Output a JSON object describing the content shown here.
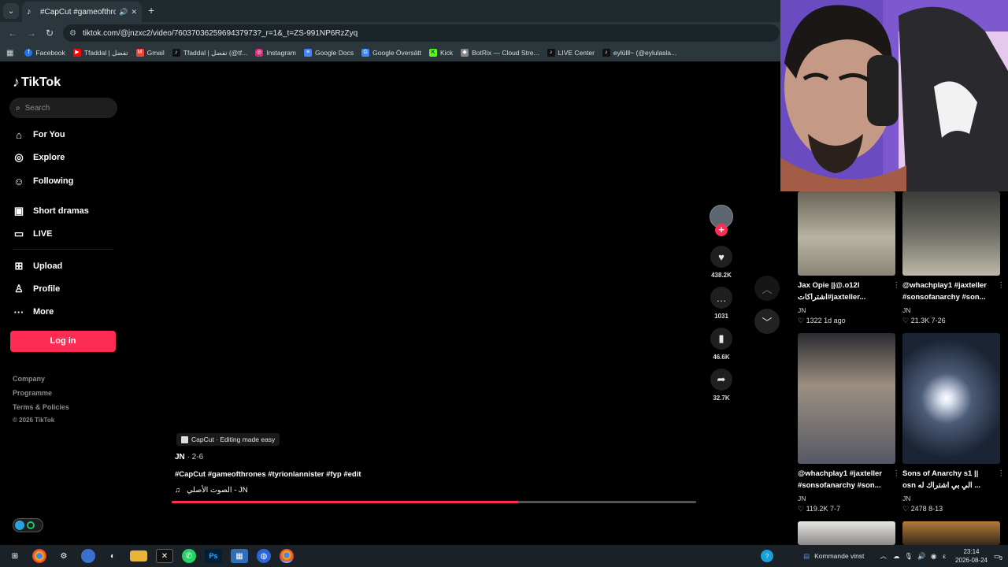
{
  "browser": {
    "tab_title": "#CapCut #gameofthrones #",
    "url": "tiktok.com/@jnzxc2/video/7603703625969437973?_r=1&_t=ZS-991NP6RzZyq",
    "bookmarks": [
      {
        "label": "Facebook",
        "icon": "facebook-icon",
        "color": "#1877f2"
      },
      {
        "label": "Tfaddal | تفضل",
        "icon": "youtube-icon",
        "color": "#ff0000"
      },
      {
        "label": "Gmail",
        "icon": "gmail-icon",
        "color": "#ea4335"
      },
      {
        "label": "Tfaddal | تفضل (@tf...",
        "icon": "tiktok-icon",
        "color": "#000000"
      },
      {
        "label": "Instagram",
        "icon": "instagram-icon",
        "color": "#d62976"
      },
      {
        "label": "Google Docs",
        "icon": "docs-icon",
        "color": "#4285f4"
      },
      {
        "label": "Google Översätt",
        "icon": "translate-icon",
        "color": "#4285f4"
      },
      {
        "label": "Kick",
        "icon": "kick-icon",
        "color": "#53fc18"
      },
      {
        "label": "BotRix — Cloud Stre...",
        "icon": "botrix-icon",
        "color": "#cccccc"
      },
      {
        "label": "LIVE Center",
        "icon": "tiktok-icon",
        "color": "#000000"
      },
      {
        "label": "eylülll~ (@eylulasla...",
        "icon": "tiktok-icon",
        "color": "#000000"
      }
    ]
  },
  "sidebar": {
    "logo": "TikTok",
    "search_placeholder": "Search",
    "nav": [
      "For You",
      "Explore",
      "Following",
      "Short dramas",
      "LIVE",
      "Upload",
      "Profile",
      "More"
    ],
    "login": "Log in",
    "footer": [
      "Company",
      "Programme",
      "Terms & Policies"
    ],
    "copyright": "© 2026 TikTok"
  },
  "video": {
    "capcut_label": "CapCut · Editing made easy",
    "author": "JN",
    "date": " · 2-6",
    "description": "#CapCut #gameofthrones #tyrionlannister #fyp #edit",
    "music": "الصوت الأصلي - JN",
    "progress": 0.66,
    "likes": "438.2K",
    "comments": "1031",
    "saves": "46.6K",
    "shares": "32.7K"
  },
  "related": [
    {
      "title": "Jax Opie ||@.o12l",
      "subtitle": "اشتراكات#jaxteller...",
      "author": "JN",
      "likes": "1322",
      "date": "1d ago"
    },
    {
      "title": "@whachplay1 #jaxteller",
      "subtitle": "#sonsofanarchy #son...",
      "author": "JN",
      "likes": "21.3K",
      "date": "7-26"
    },
    {
      "title": "@whachplay1 #jaxteller",
      "subtitle": "#sonsofanarchy #son...",
      "author": "JN",
      "likes": "119.2K",
      "date": "7-7"
    },
    {
      "title": "Sons of Anarchy s1 ||",
      "subtitle": "osn الي بي اشتراك له ...",
      "author": "JN",
      "likes": "2478",
      "date": "8-13"
    }
  ],
  "taskbar": {
    "notification": "Kommande vinst",
    "time": "23:14",
    "date": "2026-08-24",
    "lang": "ε",
    "badge": "9"
  },
  "colors": {
    "accent": "#fe2c55",
    "bg": "#000000"
  }
}
